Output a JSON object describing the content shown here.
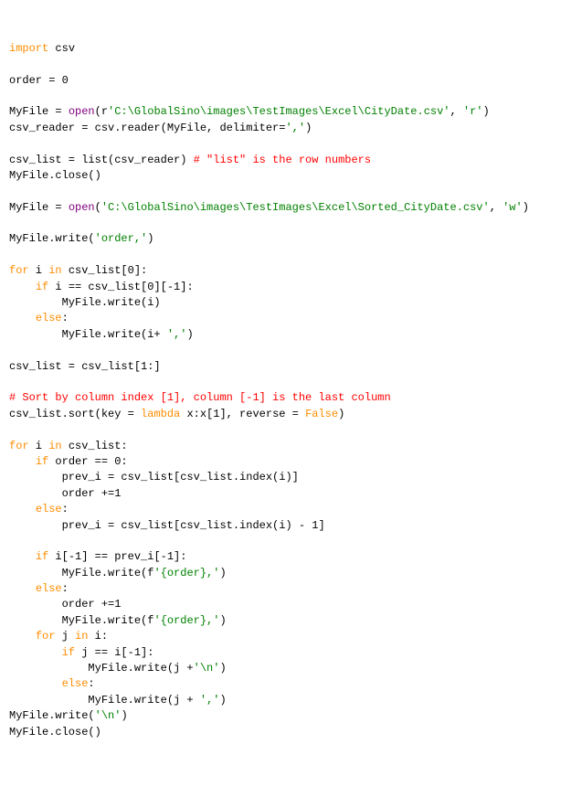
{
  "lines": [
    [
      {
        "t": "import",
        "c": "kwo"
      },
      {
        "t": " csv"
      }
    ],
    [
      {
        "t": ""
      }
    ],
    [
      {
        "t": "order = 0"
      }
    ],
    [
      {
        "t": ""
      }
    ],
    [
      {
        "t": "MyFile = "
      },
      {
        "t": "open",
        "c": "fn"
      },
      {
        "t": "(r"
      },
      {
        "t": "'C:\\GlobalSino\\images\\TestImages\\Excel\\CityDate.csv'",
        "c": "str"
      },
      {
        "t": ", "
      },
      {
        "t": "'r'",
        "c": "str"
      },
      {
        "t": ")"
      }
    ],
    [
      {
        "t": "csv_reader = csv.reader(MyFile, delimiter="
      },
      {
        "t": "','",
        "c": "str"
      },
      {
        "t": ")"
      }
    ],
    [
      {
        "t": ""
      }
    ],
    [
      {
        "t": "csv_list = list(csv_reader) "
      },
      {
        "t": "# \"list\" is the row numbers",
        "c": "cmt"
      }
    ],
    [
      {
        "t": "MyFile.close()"
      }
    ],
    [
      {
        "t": ""
      }
    ],
    [
      {
        "t": "MyFile = "
      },
      {
        "t": "open",
        "c": "fn"
      },
      {
        "t": "("
      },
      {
        "t": "'C:\\GlobalSino\\images\\TestImages\\Excel\\Sorted_CityDate.csv'",
        "c": "str"
      },
      {
        "t": ", "
      },
      {
        "t": "'w'",
        "c": "str"
      },
      {
        "t": ")"
      }
    ],
    [
      {
        "t": ""
      }
    ],
    [
      {
        "t": "MyFile.write("
      },
      {
        "t": "'order,'",
        "c": "str"
      },
      {
        "t": ")"
      }
    ],
    [
      {
        "t": ""
      }
    ],
    [
      {
        "t": "for",
        "c": "kwo"
      },
      {
        "t": " i "
      },
      {
        "t": "in",
        "c": "kwo"
      },
      {
        "t": " csv_list[0]:"
      }
    ],
    [
      {
        "t": "    "
      },
      {
        "t": "if",
        "c": "kwo"
      },
      {
        "t": " i == csv_list[0][-1]:"
      }
    ],
    [
      {
        "t": "        MyFile.write(i)"
      }
    ],
    [
      {
        "t": "    "
      },
      {
        "t": "else",
        "c": "kwo"
      },
      {
        "t": ":"
      }
    ],
    [
      {
        "t": "        MyFile.write(i+ "
      },
      {
        "t": "','",
        "c": "str"
      },
      {
        "t": ")"
      }
    ],
    [
      {
        "t": ""
      }
    ],
    [
      {
        "t": "csv_list = csv_list[1:]"
      }
    ],
    [
      {
        "t": ""
      }
    ],
    [
      {
        "t": "# Sort by column index [1], column [-1] is the last column",
        "c": "cmt"
      }
    ],
    [
      {
        "t": "csv_list.sort(key = "
      },
      {
        "t": "lambda",
        "c": "kwo"
      },
      {
        "t": " x:x[1], reverse = "
      },
      {
        "t": "False",
        "c": "bool"
      },
      {
        "t": ")"
      }
    ],
    [
      {
        "t": ""
      }
    ],
    [
      {
        "t": "for",
        "c": "kwo"
      },
      {
        "t": " i "
      },
      {
        "t": "in",
        "c": "kwo"
      },
      {
        "t": " csv_list:"
      }
    ],
    [
      {
        "t": "    "
      },
      {
        "t": "if",
        "c": "kwo"
      },
      {
        "t": " order == 0:"
      }
    ],
    [
      {
        "t": "        prev_i = csv_list[csv_list.index(i)]"
      }
    ],
    [
      {
        "t": "        order +=1"
      }
    ],
    [
      {
        "t": "    "
      },
      {
        "t": "else",
        "c": "kwo"
      },
      {
        "t": ":"
      }
    ],
    [
      {
        "t": "        prev_i = csv_list[csv_list.index(i) - 1]"
      }
    ],
    [
      {
        "t": ""
      }
    ],
    [
      {
        "t": "    "
      },
      {
        "t": "if",
        "c": "kwo"
      },
      {
        "t": " i[-1] == prev_i[-1]:"
      }
    ],
    [
      {
        "t": "        MyFile.write(f"
      },
      {
        "t": "'{order},'",
        "c": "str"
      },
      {
        "t": ")"
      }
    ],
    [
      {
        "t": "    "
      },
      {
        "t": "else",
        "c": "kwo"
      },
      {
        "t": ":"
      }
    ],
    [
      {
        "t": "        order +=1"
      }
    ],
    [
      {
        "t": "        MyFile.write(f"
      },
      {
        "t": "'{order},'",
        "c": "str"
      },
      {
        "t": ")"
      }
    ],
    [
      {
        "t": "    "
      },
      {
        "t": "for",
        "c": "kwo"
      },
      {
        "t": " j "
      },
      {
        "t": "in",
        "c": "kwo"
      },
      {
        "t": " i:"
      }
    ],
    [
      {
        "t": "        "
      },
      {
        "t": "if",
        "c": "kwo"
      },
      {
        "t": " j == i[-1]:"
      }
    ],
    [
      {
        "t": "            MyFile.write(j +"
      },
      {
        "t": "'\\n'",
        "c": "str"
      },
      {
        "t": ")"
      }
    ],
    [
      {
        "t": "        "
      },
      {
        "t": "else",
        "c": "kwo"
      },
      {
        "t": ":"
      }
    ],
    [
      {
        "t": "            MyFile.write(j + "
      },
      {
        "t": "','",
        "c": "str"
      },
      {
        "t": ")"
      }
    ],
    [
      {
        "t": "MyFile.write("
      },
      {
        "t": "'\\n'",
        "c": "str"
      },
      {
        "t": ")"
      }
    ],
    [
      {
        "t": "MyFile.close()"
      }
    ]
  ]
}
